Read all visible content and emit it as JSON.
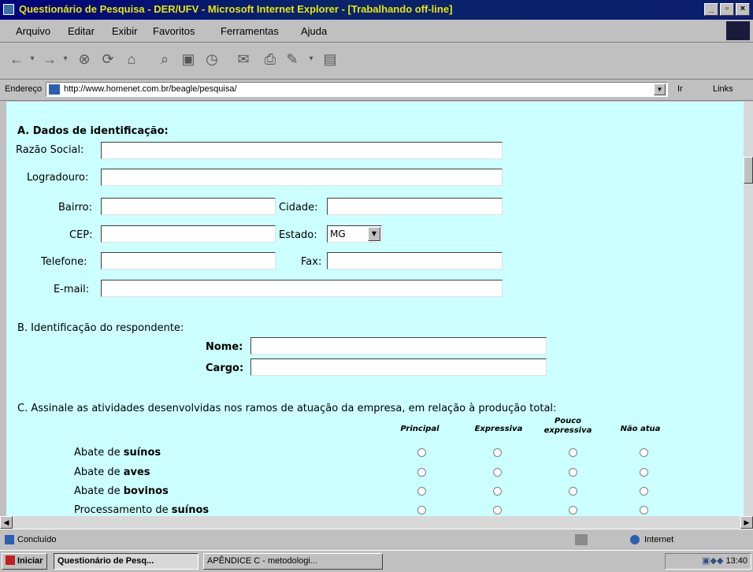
{
  "window": {
    "title": "Questionário de Pesquisa - DER/UFV - Microsoft Internet Explorer - [Trabalhando off-line]",
    "min": "_",
    "max": "▫",
    "close": "×"
  },
  "menu": [
    "Arquivo",
    "Editar",
    "Exibir",
    "Favoritos",
    "Ferramentas",
    "Ajuda"
  ],
  "address": {
    "label": "Endereço",
    "url": "http://www.homenet.com.br/beagle/pesquisa/",
    "go": "Ir",
    "links": "Links"
  },
  "form": {
    "sectionA": "A. Dados de identificação:",
    "labels": {
      "razao": "Razão Social:",
      "logradouro": "Logradouro:",
      "bairro": "Bairro:",
      "cidade": "Cidade:",
      "cep": "CEP:",
      "estado": "Estado:",
      "telefone": "Telefone:",
      "fax": "Fax:",
      "email": "E-mail:"
    },
    "estado_value": "MG",
    "sectionB": "B. Identificação do respondente:",
    "nome": "Nome:",
    "cargo": "Cargo:",
    "sectionC": "C. Assinale as atividades desenvolvidas nos ramos de atuação da empresa, em relação à produção total:",
    "columns": [
      "Principal",
      "Expressiva",
      "Pouco expressiva",
      "Não atua"
    ],
    "rows": [
      {
        "prefix": "Abate de ",
        "bold": "suínos"
      },
      {
        "prefix": "Abate de ",
        "bold": "aves"
      },
      {
        "prefix": "Abate de ",
        "bold": "bovinos"
      },
      {
        "prefix": "Processamento de ",
        "bold": "suínos"
      }
    ]
  },
  "status": {
    "text": "Concluído",
    "zone": "Internet"
  },
  "taskbar": {
    "start": "Iniciar",
    "task1": "Questionário de Pesq...",
    "task2": "APÊNDICE C - metodologi...",
    "clock": "13:40"
  }
}
